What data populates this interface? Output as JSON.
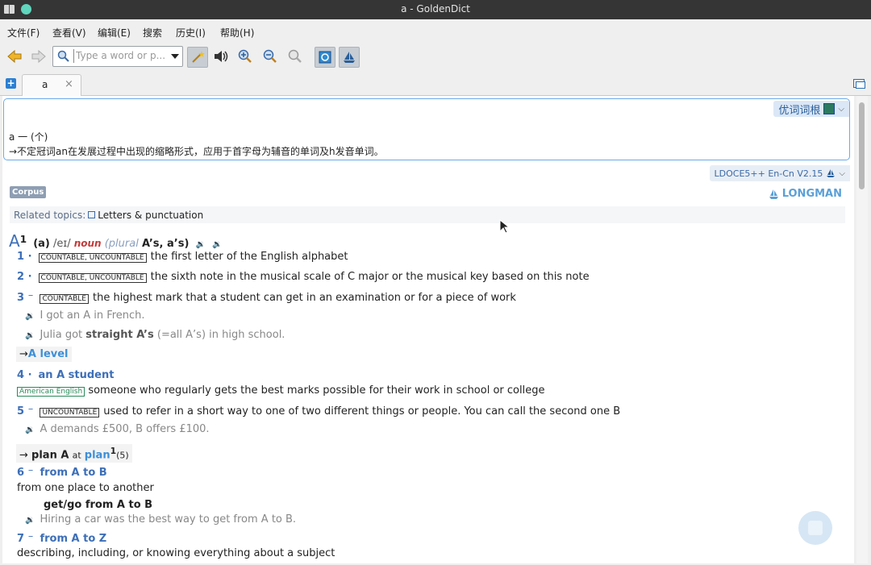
{
  "window": {
    "title": "a - GoldenDict"
  },
  "menu": {
    "items": [
      "文件(F)",
      "查看(V)",
      "编辑(E)",
      "搜索",
      "历史(I)",
      "帮助(H)"
    ]
  },
  "search": {
    "placeholder": "Type a word or p..."
  },
  "tabs": [
    {
      "label": "a",
      "close": "×"
    }
  ],
  "article1": {
    "dict_name": "优词词根",
    "line1": "a 一 (个)",
    "line2": "→不定冠词an在发展过程中出现的缩略形式，应用于首字母为辅音的单词及h发音单词。"
  },
  "article2": {
    "dict_name": "LDOCE5++ En-Cn V2.15",
    "corpus": "Corpus",
    "brand": "LONGMAN",
    "related_label": "Related topics:",
    "related_topic": "Letters & punctuation",
    "hw": {
      "word": "A",
      "sup": "1",
      "alt": "(a)",
      "pron": "/eɪ/",
      "pos": "noun",
      "plural_label": "(plural",
      "plural_forms": "A’s, a’s)"
    },
    "senses": [
      {
        "num": "1",
        "mark": "·",
        "label": "COUNTABLE, UNCOUNTABLE",
        "def": "the first letter of the English alphabet"
      },
      {
        "num": "2",
        "mark": "·",
        "label": "COUNTABLE, UNCOUNTABLE",
        "def": "the sixth note in the musical scale of C major or the musical key based on this note"
      },
      {
        "num": "3",
        "mark": "⁻",
        "label": "COUNTABLE",
        "def": "the highest mark that a student can get in an examination or for a piece of work"
      }
    ],
    "ex3a": "I got an A in French.",
    "ex3b_pre": "Julia got",
    "ex3b_bold": "straight A’s",
    "ex3b_post": "(=all A’s) in high school.",
    "xref1_arrow": "→",
    "xref1": "A level",
    "s4": {
      "num": "4",
      "mark": "·",
      "phrase": "an A student",
      "label": "American English",
      "def": "someone who regularly gets the best marks possible for their work in school or college"
    },
    "s5": {
      "num": "5",
      "mark": "⁻",
      "label": "UNCOUNTABLE",
      "def": "used to refer in a short way to one of two different things or people. You can call the second one B"
    },
    "ex5": "A demands £500, B offers £100.",
    "xref2": {
      "arrow": "→",
      "bold": "plan A",
      "at": "at",
      "link": "plan",
      "sup": "1",
      "ref": "(5)"
    },
    "s6": {
      "num": "6",
      "mark": "⁻",
      "phrase": "from A to B",
      "def": "from one place to another",
      "sub": "get/go from A to B",
      "ex": "Hiring a car was the best way to get from A to B."
    },
    "s7": {
      "num": "7",
      "mark": "⁻",
      "phrase": "from A to Z",
      "def": "describing, including, or knowing everything about a subject"
    }
  }
}
